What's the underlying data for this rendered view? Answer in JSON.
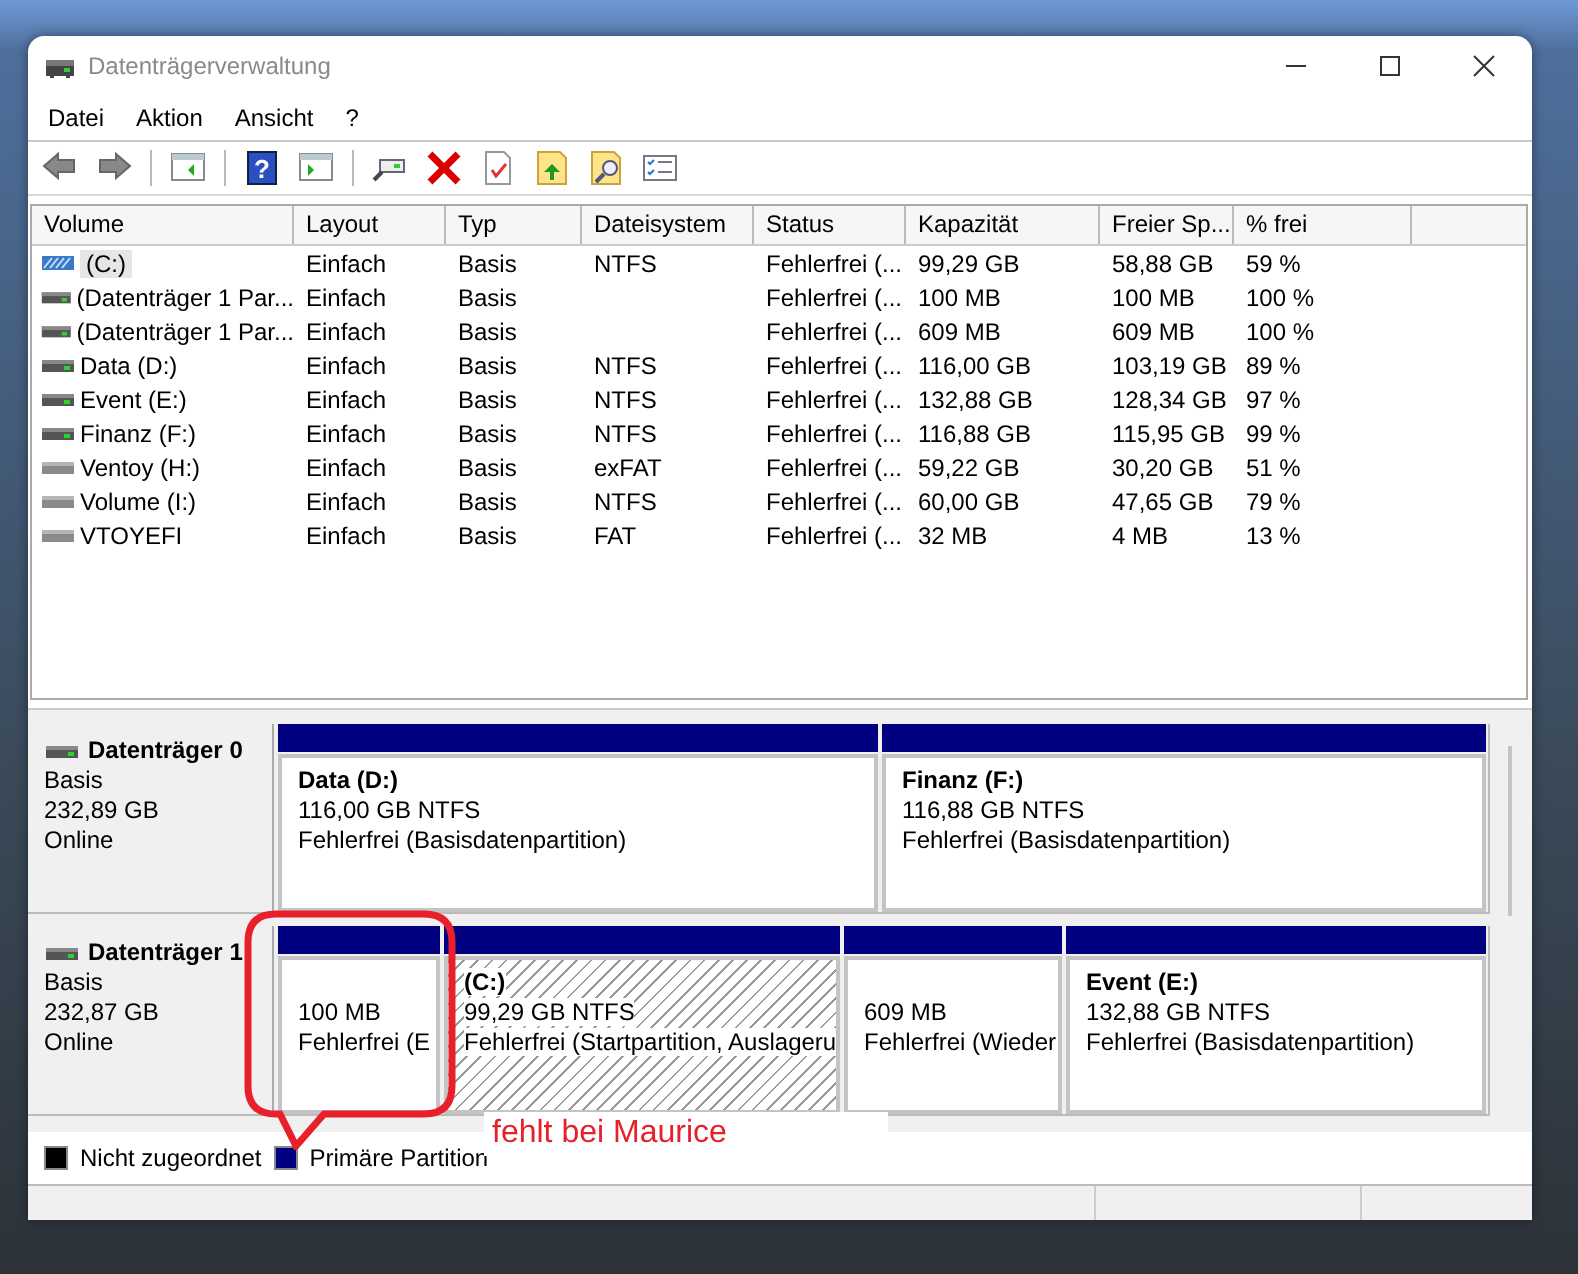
{
  "window": {
    "title": "Datenträgerverwaltung"
  },
  "menu": [
    "Datei",
    "Aktion",
    "Ansicht",
    "?"
  ],
  "toolbar": {
    "help_icon": "?"
  },
  "volume_table": {
    "columns": [
      "Volume",
      "Layout",
      "Typ",
      "Dateisystem",
      "Status",
      "Kapazität",
      "Freier Sp...",
      "% frei"
    ],
    "rows": [
      {
        "kind": "system",
        "selected": true,
        "cells": [
          "(C:)",
          "Einfach",
          "Basis",
          "NTFS",
          "Fehlerfrei (...",
          "99,29 GB",
          "58,88 GB",
          "59 %"
        ]
      },
      {
        "kind": "basic",
        "selected": false,
        "cells": [
          "(Datenträger 1 Par...",
          "Einfach",
          "Basis",
          "",
          "Fehlerfrei (...",
          "100 MB",
          "100 MB",
          "100 %"
        ]
      },
      {
        "kind": "basic",
        "selected": false,
        "cells": [
          "(Datenträger 1 Par...",
          "Einfach",
          "Basis",
          "",
          "Fehlerfrei (...",
          "609 MB",
          "609 MB",
          "100 %"
        ]
      },
      {
        "kind": "basic",
        "selected": false,
        "cells": [
          "Data (D:)",
          "Einfach",
          "Basis",
          "NTFS",
          "Fehlerfrei (...",
          "116,00 GB",
          "103,19 GB",
          "89 %"
        ]
      },
      {
        "kind": "basic",
        "selected": false,
        "cells": [
          "Event (E:)",
          "Einfach",
          "Basis",
          "NTFS",
          "Fehlerfrei (...",
          "132,88 GB",
          "128,34 GB",
          "97 %"
        ]
      },
      {
        "kind": "basic",
        "selected": false,
        "cells": [
          "Finanz (F:)",
          "Einfach",
          "Basis",
          "NTFS",
          "Fehlerfrei (...",
          "116,88 GB",
          "115,95 GB",
          "99 %"
        ]
      },
      {
        "kind": "removable",
        "selected": false,
        "cells": [
          "Ventoy (H:)",
          "Einfach",
          "Basis",
          "exFAT",
          "Fehlerfrei (...",
          "59,22 GB",
          "30,20 GB",
          "51 %"
        ]
      },
      {
        "kind": "removable",
        "selected": false,
        "cells": [
          "Volume (I:)",
          "Einfach",
          "Basis",
          "NTFS",
          "Fehlerfrei (...",
          "60,00 GB",
          "47,65 GB",
          "79 %"
        ]
      },
      {
        "kind": "removable",
        "selected": false,
        "cells": [
          "VTOYEFI",
          "Einfach",
          "Basis",
          "FAT",
          "Fehlerfrei (...",
          "32 MB",
          "4 MB",
          "13 %"
        ]
      }
    ]
  },
  "disks": [
    {
      "name": "Datenträger 0",
      "type": "Basis",
      "size": "232,89 GB",
      "state": "Online",
      "partitions": [
        {
          "label": "Data  (D:)",
          "size": "116,00 GB NTFS",
          "status": "Fehlerfrei (Basisdatenpartition)",
          "selected": false
        },
        {
          "label": "Finanz  (F:)",
          "size": "116,88 GB NTFS",
          "status": "Fehlerfrei (Basisdatenpartition)",
          "selected": false
        }
      ]
    },
    {
      "name": "Datenträger 1",
      "type": "Basis",
      "size": "232,87 GB",
      "state": "Online",
      "partitions": [
        {
          "size": "100 MB",
          "status": "Fehlerfrei (E",
          "selected": false
        },
        {
          "label": "(C:)",
          "size": "99,29 GB NTFS",
          "status": "Fehlerfrei (Startpartition, Auslageru",
          "selected": true
        },
        {
          "size": "609 MB",
          "status": "Fehlerfrei (Wieder",
          "selected": false
        },
        {
          "label": "Event  (E:)",
          "size": "132,88 GB NTFS",
          "status": "Fehlerfrei (Basisdatenpartition)",
          "selected": false
        }
      ]
    }
  ],
  "legend": [
    {
      "label": "Nicht zugeordnet",
      "color": "#000000"
    },
    {
      "label": "Primäre Partition",
      "color": "#000080"
    }
  ],
  "annotation": {
    "text": "fehlt bei Maurice"
  }
}
